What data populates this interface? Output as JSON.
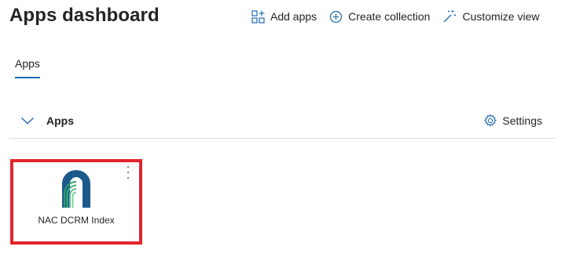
{
  "header": {
    "title": "Apps dashboard"
  },
  "toolbar": {
    "add_apps_label": "Add apps",
    "create_collection_label": "Create collection",
    "customize_view_label": "Customize view"
  },
  "tabs": [
    {
      "label": "Apps",
      "selected": true
    }
  ],
  "section": {
    "title": "Apps",
    "expanded": true,
    "settings_label": "Settings"
  },
  "apps": [
    {
      "name": "NAC DCRM Index",
      "icon": "arch-logo-icon",
      "highlighted": true
    }
  ],
  "colors": {
    "accent": "#1f6bb1",
    "highlight_border": "#e3242b",
    "logo_blue": "#1c5a8c",
    "logo_green": "#2e9e6b"
  }
}
